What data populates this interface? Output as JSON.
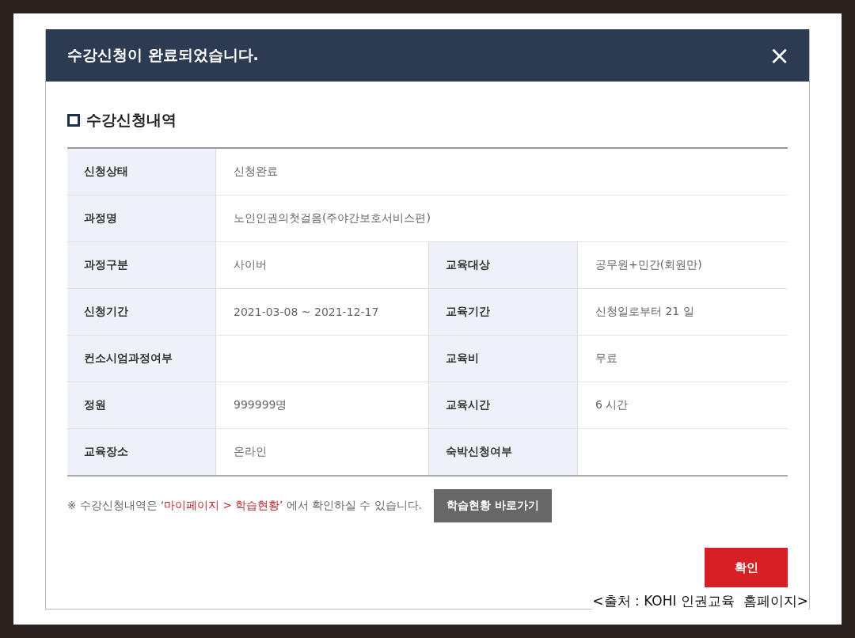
{
  "dialog": {
    "title": "수강신청이 완료되었습니다.",
    "close": "×"
  },
  "section_title": "수강신청내역",
  "table": {
    "rows": [
      [
        {
          "label": "신청상태",
          "value": "신청완료"
        }
      ],
      [
        {
          "label": "과정명",
          "value": "노인인권의첫걸음(주야간보호서비스편)"
        }
      ],
      [
        {
          "label": "과정구분",
          "value": "사이버"
        },
        {
          "label": "교육대상",
          "value": "공무원+민간(회원만)"
        }
      ],
      [
        {
          "label": "신청기간",
          "value": "2021-03-08 ~ 2021-12-17"
        },
        {
          "label": "교육기간",
          "value": "신청일로부터 21 일"
        }
      ],
      [
        {
          "label": "컨소시엄과정여부"
        },
        {
          "label": "교육비",
          "value": "무료"
        }
      ],
      [
        {
          "label": "정원",
          "value": "999999명"
        },
        {
          "label": "교육시간",
          "value": "6 시간"
        }
      ],
      [
        {
          "label": "교육장소",
          "value": "온라인"
        },
        {
          "label": "숙박신청여부"
        }
      ]
    ]
  },
  "note": {
    "before": "※ 수강신청내역은",
    "highlight": "‘마이페이지 > 학습현황’",
    "after": "에서 확인하실 수 있습니다."
  },
  "shortcut_button": "학습현황 바로가기",
  "confirm_button": "확인",
  "caption": "<출처 : KOHI 인권교육  홈페이지>"
}
